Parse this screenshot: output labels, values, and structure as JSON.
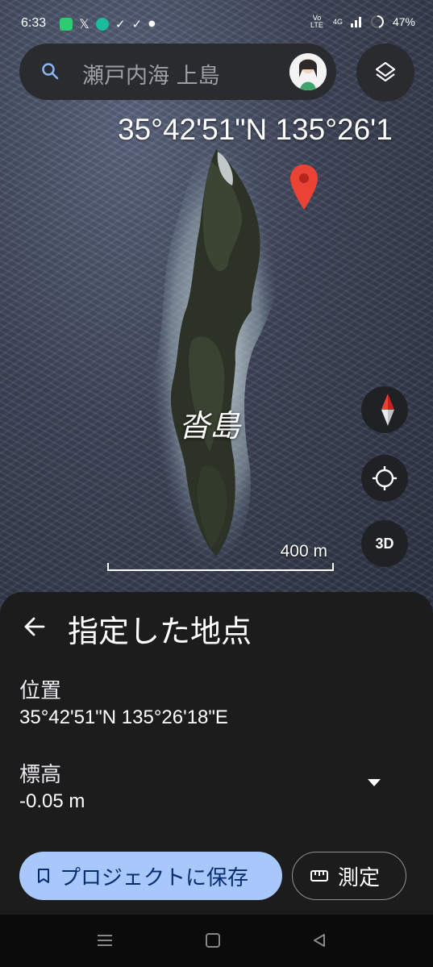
{
  "status_bar": {
    "time": "6:33",
    "network": "4G",
    "volte": "Vo LTE",
    "battery": "47%",
    "icons": [
      "app-icon",
      "x-icon",
      "chat-icon",
      "check-icon",
      "check-icon",
      "dot-icon"
    ]
  },
  "search": {
    "query": "瀬戸内海 上島",
    "icon": "search-icon"
  },
  "map": {
    "coordinate_overlay": "35°42'51\"N 135°26'1",
    "island_label": "沓島",
    "scale_label": "400 m",
    "three_d_label": "3D"
  },
  "sheet": {
    "title": "指定した地点",
    "location_label": "位置",
    "location_value": "35°42'51\"N 135°26'18\"E",
    "elevation_label": "標高",
    "elevation_value": "-0.05 m",
    "save_button": "プロジェクトに保存",
    "measure_button": "測定"
  },
  "colors": {
    "save_button_bg": "#a8c7fa",
    "sheet_bg": "#1c1c1c",
    "pin": "#ea4335"
  }
}
